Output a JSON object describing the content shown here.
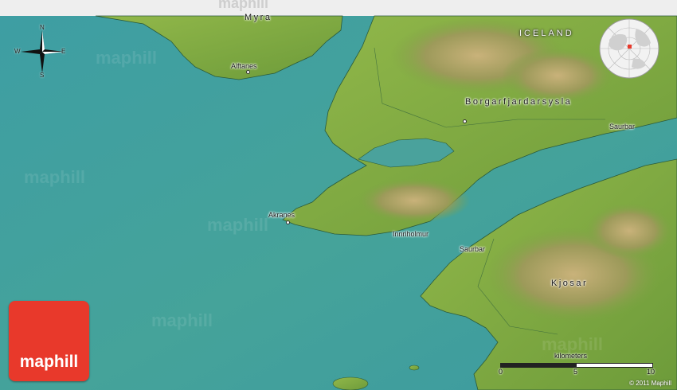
{
  "map": {
    "country_label": "ICELAND",
    "region_labels": [
      "Borgarfjardarsysla",
      "Kjosar"
    ],
    "places": [
      {
        "name": "Myra"
      },
      {
        "name": "Alftanes"
      },
      {
        "name": "Saurbar"
      },
      {
        "name": "Akranes"
      },
      {
        "name": "Innriholmur"
      },
      {
        "name": "Saurbar"
      }
    ],
    "compass": {
      "n": "N",
      "s": "S",
      "e": "E",
      "w": "W"
    },
    "scale": {
      "unit": "kilometers",
      "min": "0",
      "mid": "5",
      "max": "10"
    },
    "colors": {
      "sea": "#3f9ea0",
      "land": "#86b144",
      "mountain": "#b6a06a",
      "logo": "#e8392b"
    }
  },
  "brand": {
    "logo_text": "maphill",
    "watermark": "maphill",
    "copyright": "© 2011 Maphill"
  }
}
